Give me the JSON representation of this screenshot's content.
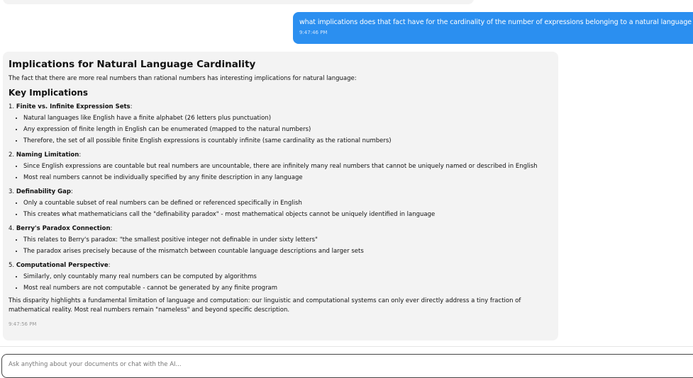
{
  "user_message": {
    "text": "what implications does that fact have for the cardinality of the number of expressions belonging to a natural language such as english?",
    "time": "9:47:46 PM"
  },
  "ai_message": {
    "title": "Implications for Natural Language Cardinality",
    "intro": "The fact that there are more real numbers than rational numbers has interesting implications for natural language:",
    "subtitle": "Key Implications",
    "sections": [
      {
        "number": "1.",
        "heading": "Finite vs. Infinite Expression Sets",
        "points": [
          "Natural languages like English have a finite alphabet (26 letters plus punctuation)",
          "Any expression of finite length in English can be enumerated (mapped to the natural numbers)",
          "Therefore, the set of all possible finite English expressions is countably infinite (same cardinality as the rational numbers)"
        ]
      },
      {
        "number": "2.",
        "heading": "Naming Limitation",
        "points": [
          "Since English expressions are countable but real numbers are uncountable, there are infinitely many real numbers that cannot be uniquely named or described in English",
          "Most real numbers cannot be individually specified by any finite description in any language"
        ]
      },
      {
        "number": "3.",
        "heading": "Definability Gap",
        "points": [
          "Only a countable subset of real numbers can be defined or referenced specifically in English",
          "This creates what mathematicians call the \"definability paradox\" - most mathematical objects cannot be uniquely identified in language"
        ]
      },
      {
        "number": "4.",
        "heading": "Berry's Paradox Connection",
        "points": [
          "This relates to Berry's paradox: \"the smallest positive integer not definable in under sixty letters\"",
          "The paradox arises precisely because of the mismatch between countable language descriptions and larger sets"
        ]
      },
      {
        "number": "5.",
        "heading": "Computational Perspective",
        "points": [
          "Similarly, only countably many real numbers can be computed by algorithms",
          "Most real numbers are not computable - cannot be generated by any finite program"
        ]
      }
    ],
    "conclusion": "This disparity highlights a fundamental limitation of language and computation: our linguistic and computational systems can only ever directly address a tiny fraction of mathematical reality. Most real numbers remain \"nameless\" and beyond specific description.",
    "time": "9:47:56 PM"
  },
  "composer": {
    "placeholder": "Ask anything about your documents or chat with the AI..."
  }
}
